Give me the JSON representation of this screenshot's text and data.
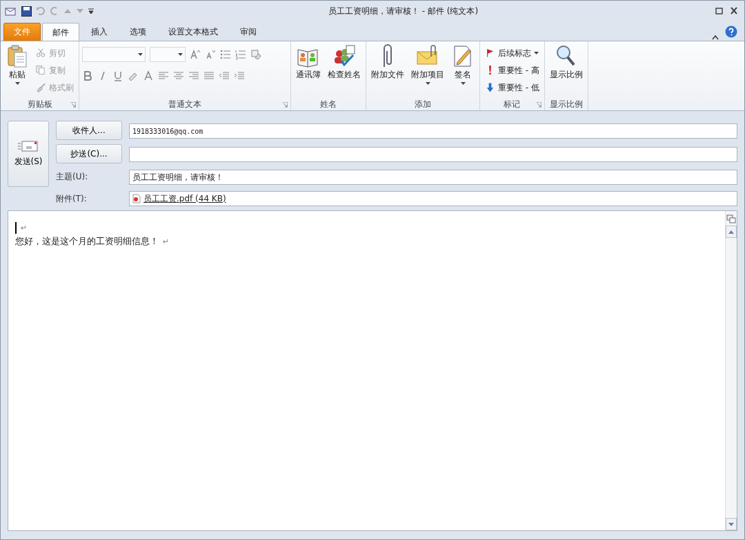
{
  "window": {
    "title": "员工工资明细，请审核！ - 邮件 (纯文本)"
  },
  "tabs": [
    {
      "label": "文件",
      "kind": "file",
      "selected": false
    },
    {
      "label": "邮件",
      "kind": "tab",
      "selected": true
    },
    {
      "label": "插入",
      "kind": "tab",
      "selected": false
    },
    {
      "label": "选项",
      "kind": "tab",
      "selected": false
    },
    {
      "label": "设置文本格式",
      "kind": "tab",
      "selected": false
    },
    {
      "label": "审阅",
      "kind": "tab",
      "selected": false
    }
  ],
  "ribbon": {
    "groups": [
      {
        "label": "剪贴板",
        "launcher": true,
        "kind": "clipboard",
        "items": [
          {
            "label": "粘贴",
            "kind": "large",
            "dropdown": true,
            "disabled": false
          },
          {
            "label": "剪切",
            "kind": "small",
            "disabled": true
          },
          {
            "label": "复制",
            "kind": "small",
            "disabled": true
          },
          {
            "label": "格式刷",
            "kind": "small",
            "disabled": true
          }
        ]
      },
      {
        "label": "普通文本",
        "launcher": true,
        "kind": "font"
      },
      {
        "label": "姓名",
        "kind": "large",
        "items": [
          {
            "label": "通讯簿",
            "kind": "large"
          },
          {
            "label": "检查姓名",
            "kind": "large"
          }
        ]
      },
      {
        "label": "添加",
        "kind": "large",
        "items": [
          {
            "label": "附加文件",
            "kind": "large"
          },
          {
            "label": "附加项目",
            "kind": "large",
            "dropdown": true
          },
          {
            "label": "签名",
            "kind": "large",
            "dropdown": true
          }
        ]
      },
      {
        "label": "标记",
        "launcher": true,
        "kind": "small",
        "items": [
          {
            "label": "后续标志",
            "kind": "small",
            "dropdown": true
          },
          {
            "label": "重要性 - 高",
            "kind": "small"
          },
          {
            "label": "重要性 - 低",
            "kind": "small"
          }
        ]
      },
      {
        "label": "显示比例",
        "kind": "large",
        "items": [
          {
            "label": "显示比例",
            "kind": "large"
          }
        ]
      }
    ]
  },
  "send": {
    "label": "发送(S)"
  },
  "fields": [
    {
      "kind": "button",
      "label": "收件人...",
      "value": "1918333016@qq.com"
    },
    {
      "kind": "button",
      "label": "抄送(C)..."
    },
    {
      "kind": "label",
      "label": "主题(U):",
      "value": "员工工资明细，请审核！"
    },
    {
      "kind": "attachment",
      "label": "附件(T):",
      "value": "员工工资.pdf (44 KB)"
    }
  ],
  "body": {
    "lines": [
      {
        "caret": true,
        "mark": "↵"
      },
      {
        "caret": false,
        "text": "您好，这是这个月的工资明细信息！",
        "mark": "↵"
      }
    ]
  }
}
